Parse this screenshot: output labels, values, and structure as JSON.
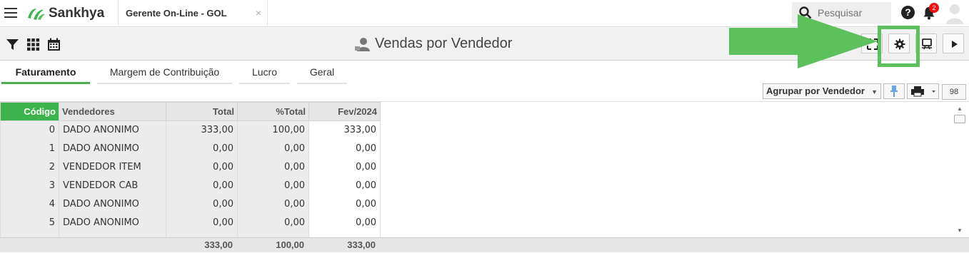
{
  "app": {
    "logo_text": "Sankhya"
  },
  "tab": {
    "label": "Gerente On-Line - GOL",
    "close": "×"
  },
  "search": {
    "placeholder": "Pesquisar"
  },
  "help": {
    "label": "?"
  },
  "notifications": {
    "count": "2"
  },
  "page": {
    "title": "Vendas por Vendedor"
  },
  "tabs": [
    {
      "label": "Faturamento"
    },
    {
      "label": "Margem de Contribuição"
    },
    {
      "label": "Lucro"
    },
    {
      "label": "Geral"
    }
  ],
  "grid_toolbar": {
    "group_by": "Agrupar por Vendedor",
    "record_count": "98"
  },
  "table": {
    "headers": [
      "Código",
      "Vendedores",
      "Total",
      "%Total",
      "Fev/2024"
    ],
    "rows": [
      [
        "0",
        "DADO ANONIMO",
        "333,00",
        "100,00",
        "333,00"
      ],
      [
        "1",
        "DADO ANONIMO",
        "0,00",
        "0,00",
        "0,00"
      ],
      [
        "2",
        "VENDEDOR ITEM",
        "0,00",
        "0,00",
        "0,00"
      ],
      [
        "3",
        "VENDEDOR CAB",
        "0,00",
        "0,00",
        "0,00"
      ],
      [
        "4",
        "DADO ANONIMO",
        "0,00",
        "0,00",
        "0,00"
      ],
      [
        "5",
        "DADO ANONIMO",
        "0,00",
        "0,00",
        "0,00"
      ]
    ],
    "totals": [
      "333,00",
      "100,00",
      "333,00"
    ]
  },
  "colors": {
    "accent": "#3cb44b",
    "highlight": "#5cc05c",
    "badge": "#e11111"
  }
}
